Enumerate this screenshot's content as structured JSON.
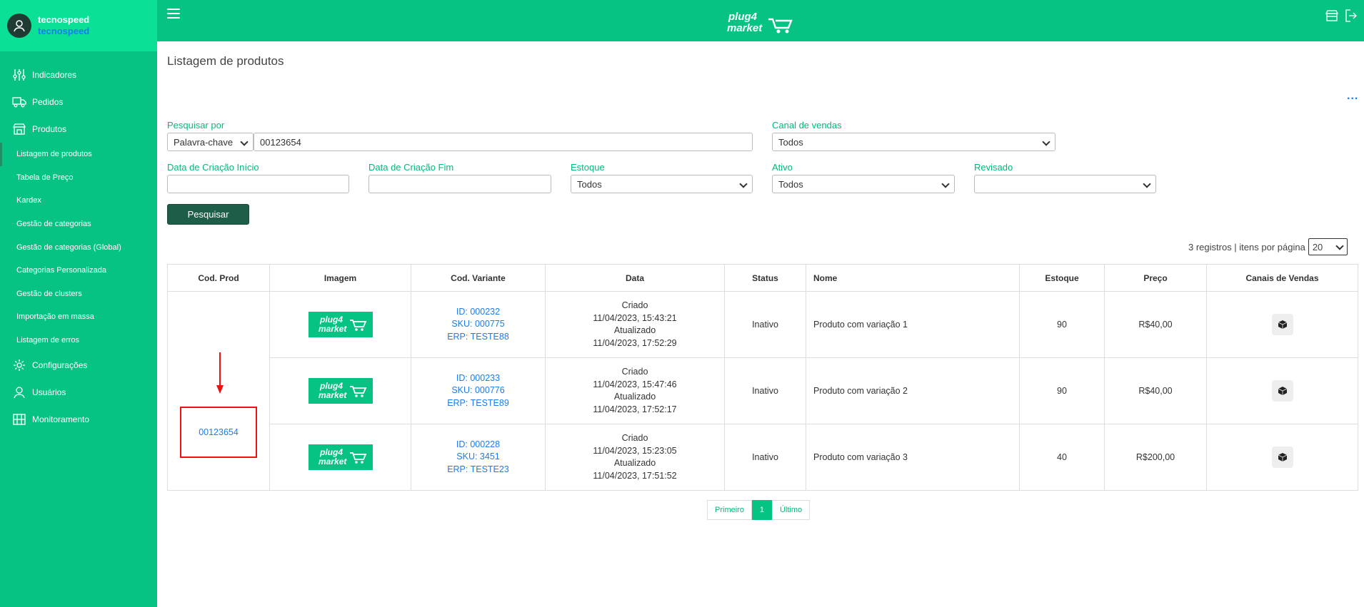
{
  "user": {
    "name": "tecnospeed",
    "company": "tecnospeed"
  },
  "nav": [
    {
      "label": "Indicadores",
      "icon": "sliders-icon"
    },
    {
      "label": "Pedidos",
      "icon": "truck-icon"
    },
    {
      "label": "Produtos",
      "icon": "store-icon"
    }
  ],
  "subnav": [
    "Listagem de produtos",
    "Tabela de Preço",
    "Kardex",
    "Gestão de categorias",
    "Gestão de categorias (Global)",
    "Categorias Personalizada",
    "Gestão de clusters",
    "Importação em massa",
    "Listagem de erros"
  ],
  "nav_bottom": [
    {
      "label": "Configurações",
      "icon": "gear-icon"
    },
    {
      "label": "Usuários",
      "icon": "user-icon"
    },
    {
      "label": "Monitoramento",
      "icon": "monitor-icon"
    }
  ],
  "logo": {
    "line1": "plug4",
    "line2": "market"
  },
  "page": {
    "title": "Listagem de produtos",
    "more": "..."
  },
  "filters": {
    "search_label": "Pesquisar por",
    "search_type": "Palavra-chave",
    "search_value": "00123654",
    "channel_label": "Canal de vendas",
    "channel_value": "Todos",
    "date_start_label": "Data de Criação Início",
    "date_end_label": "Data de Criação Fim",
    "stock_label": "Estoque",
    "stock_value": "Todos",
    "active_label": "Ativo",
    "active_value": "Todos",
    "reviewed_label": "Revisado",
    "reviewed_value": "",
    "search_button": "Pesquisar"
  },
  "results": {
    "count_text": "3 registros | itens por página",
    "per_page": "20"
  },
  "table": {
    "headers": [
      "Cod. Prod",
      "Imagem",
      "Cod. Variante",
      "Data",
      "Status",
      "Nome",
      "Estoque",
      "Preço",
      "Canais de Vendas"
    ],
    "product_code": "00123654",
    "rows": [
      {
        "id": "ID: 000232",
        "sku": "SKU: 000775",
        "erp": "ERP: TESTE88",
        "created_label": "Criado",
        "created": "11/04/2023, 15:43:21",
        "updated_label": "Atualizado",
        "updated": "11/04/2023, 17:52:29",
        "status": "Inativo",
        "name": "Produto com variação 1",
        "stock": "90",
        "price": "R$40,00"
      },
      {
        "id": "ID: 000233",
        "sku": "SKU: 000776",
        "erp": "ERP: TESTE89",
        "created_label": "Criado",
        "created": "11/04/2023, 15:47:46",
        "updated_label": "Atualizado",
        "updated": "11/04/2023, 17:52:17",
        "status": "Inativo",
        "name": "Produto com variação 2",
        "stock": "90",
        "price": "R$40,00"
      },
      {
        "id": "ID: 000228",
        "sku": "SKU: 3451",
        "erp": "ERP: TESTE23",
        "created_label": "Criado",
        "created": "11/04/2023, 15:23:05",
        "updated_label": "Atualizado",
        "updated": "11/04/2023, 17:51:52",
        "status": "Inativo",
        "name": "Produto com variação 3",
        "stock": "40",
        "price": "R$200,00"
      }
    ]
  },
  "pagination": {
    "first": "Primeiro",
    "current": "1",
    "last": "Último"
  },
  "colors": {
    "brand": "#06c383",
    "brand_light": "#0be097",
    "button": "#1e5d47",
    "link": "#1b7cf0",
    "highlight": "#ee1111"
  }
}
